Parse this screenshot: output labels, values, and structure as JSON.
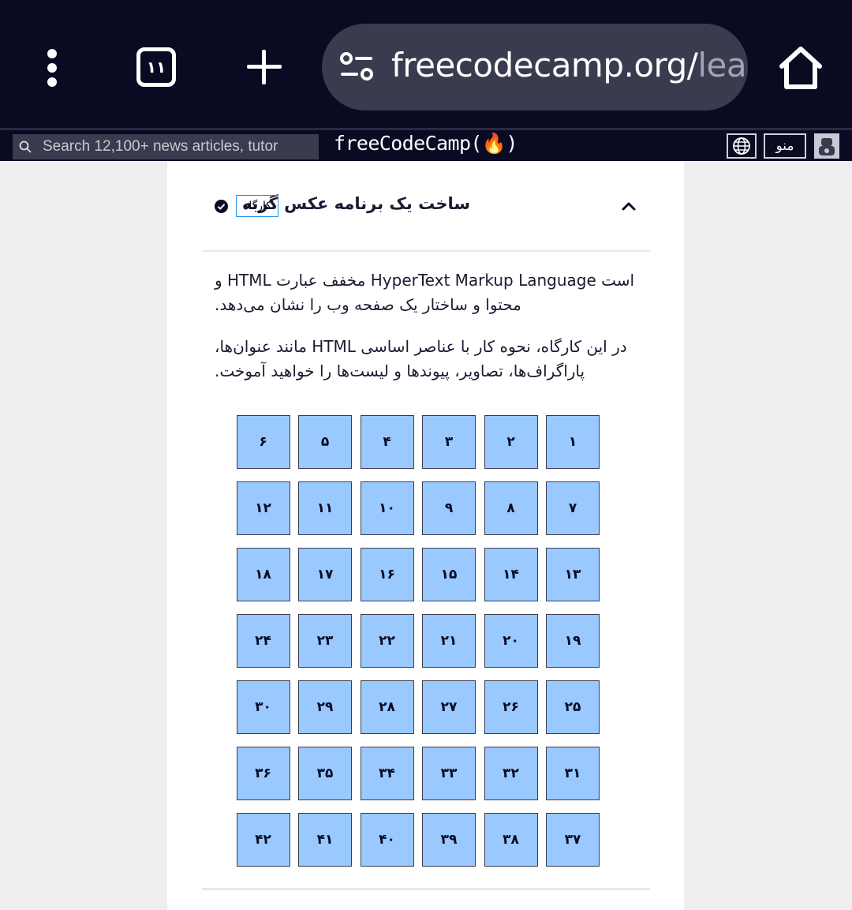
{
  "browser": {
    "tab_count": "۱۱",
    "url_main": "freecodecamp.org/",
    "url_rest": "lea"
  },
  "nav": {
    "search_placeholder": "Search 12,100+ news articles, tutor",
    "logo_text": "freeCodeCamp(🔥)",
    "menu_label": "منو"
  },
  "block": {
    "title": "ساخت یک برنامه عکس گربه",
    "badge": "کارگاه",
    "description_1": "است HyperText Markup Language مخفف عبارت HTML و محتوا و ساختار یک صفحه وب را نشان می‌دهد.",
    "description_2": "در این کارگاه، نحوه کار با عناصر اساسی HTML مانند عنوان‌ها، پاراگراف‌ها، تصاویر، پیوندها و لیست‌ها را خواهید آموخت.",
    "steps": [
      "۱",
      "۲",
      "۳",
      "۴",
      "۵",
      "۶",
      "۷",
      "۸",
      "۹",
      "۱۰",
      "۱۱",
      "۱۲",
      "۱۳",
      "۱۴",
      "۱۵",
      "۱۶",
      "۱۷",
      "۱۸",
      "۱۹",
      "۲۰",
      "۲۱",
      "۲۲",
      "۲۳",
      "۲۴",
      "۲۵",
      "۲۶",
      "۲۷",
      "۲۸",
      "۲۹",
      "۳۰",
      "۳۱",
      "۳۲",
      "۳۳",
      "۳۴",
      "۳۵",
      "۳۶",
      "۳۷",
      "۳۸",
      "۳۹",
      "۴۰",
      "۴۱",
      "۴۲"
    ]
  },
  "colors": {
    "nav_bg": "#0a0a23",
    "step_fill": "#99c9ff",
    "badge_border": "#198eee"
  },
  "icons": [
    "kebab-menu-icon",
    "tabs-icon",
    "plus-icon",
    "site-settings-icon",
    "home-icon",
    "search-icon",
    "globe-icon",
    "avatar-icon",
    "chevron-up-icon",
    "check-circle-icon"
  ]
}
